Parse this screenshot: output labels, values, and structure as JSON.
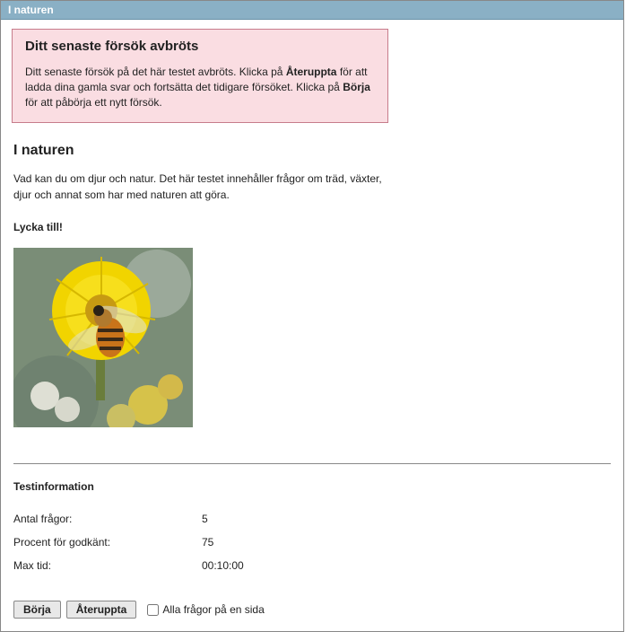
{
  "window": {
    "title": "I naturen"
  },
  "alert": {
    "title": "Ditt senaste försök avbröts",
    "body_pre": "Ditt senaste försök på det här testet avbröts. Klicka på ",
    "body_bold1": "Återuppta",
    "body_mid": " för att ladda dina gamla svar och fortsätta det tidigare försöket. Klicka på ",
    "body_bold2": "Börja",
    "body_post": " för att påbörja ett nytt försök."
  },
  "main": {
    "heading": "I naturen",
    "intro": "Vad kan du om djur och natur. Det här testet innehåller frågor om träd, växter, djur och annat som har med naturen att göra.",
    "good_luck": "Lycka till!"
  },
  "testinfo": {
    "title": "Testinformation",
    "rows": [
      {
        "label": "Antal frågor:",
        "value": "5"
      },
      {
        "label": "Procent för godkänt:",
        "value": "75"
      },
      {
        "label": "Max tid:",
        "value": "00:10:00"
      }
    ]
  },
  "buttons": {
    "start": "Börja",
    "resume": "Återuppta",
    "all_on_one_page": "Alla frågor på en sida"
  }
}
